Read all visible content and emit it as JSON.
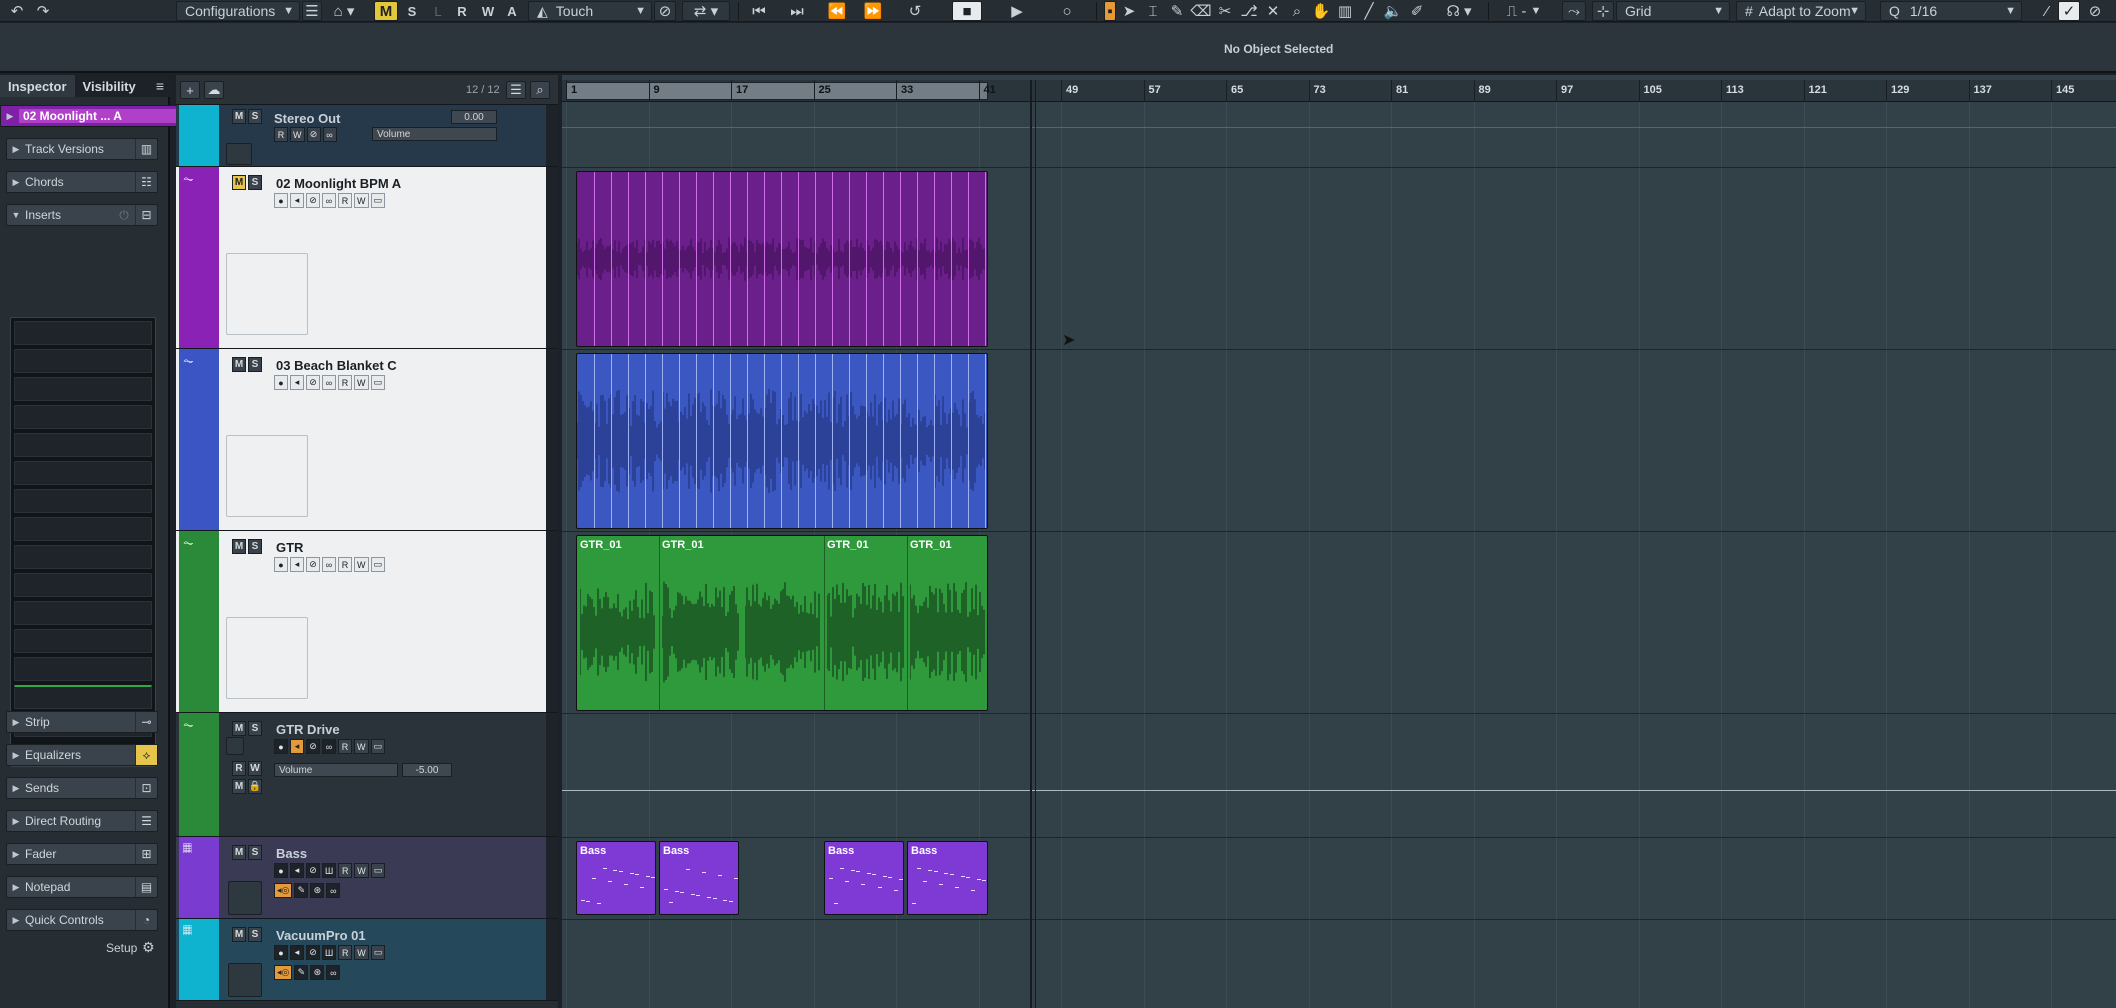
{
  "toolbar": {
    "configurations_label": "Configurations",
    "automation_mode": "Touch",
    "grid_type": "Grid",
    "zoom_mode": "Adapt to Zoom",
    "quantize_value": "1/16",
    "mute_indicator": "M",
    "solo_indicator": "S",
    "listen_indicator": "L",
    "read_indicator": "R",
    "write_indicator": "W",
    "auto_indicator": "A",
    "nudge_value": "-"
  },
  "info_line": {
    "status": "No Object Selected"
  },
  "inspector": {
    "tabs": [
      "Inspector",
      "Visibility"
    ],
    "track_name": "02 Moonlight ... A",
    "sections_top": [
      "Track Versions",
      "Chords",
      "Inserts"
    ],
    "sections_bottom": [
      "Strip",
      "Equalizers",
      "Sends",
      "Direct Routing",
      "Fader",
      "Notepad",
      "Quick Controls"
    ],
    "setup_label": "Setup"
  },
  "tracklist": {
    "track_count": "12 / 12",
    "tracks": [
      {
        "name": "Stereo Out",
        "color": "#0fb3d0",
        "volume_label": "Volume",
        "volume_value": "0.00"
      },
      {
        "name": "02 Moonlight BPM A",
        "color": "#8a22b5"
      },
      {
        "name": "03 Beach Blanket C",
        "color": "#3b55c4"
      },
      {
        "name": "GTR",
        "color": "#2a8a3a"
      },
      {
        "name": "GTR Drive",
        "color": "#2a8a3a",
        "volume_label": "Volume",
        "volume_value": "-5.00"
      },
      {
        "name": "Bass",
        "color": "#7a3bd0"
      },
      {
        "name": "VacuumPro 01",
        "color": "#0fb3d0"
      }
    ]
  },
  "ruler": {
    "bars": [
      "1",
      "9",
      "17",
      "25",
      "33",
      "41",
      "49",
      "57",
      "65",
      "73",
      "81",
      "89",
      "97",
      "105",
      "113",
      "121",
      "129",
      "137",
      "145"
    ]
  },
  "clips": {
    "gtr": [
      "GTR_01",
      "GTR_01",
      "GTR_01",
      "GTR_01"
    ],
    "bass": [
      "Bass",
      "Bass",
      "Bass",
      "Bass"
    ]
  },
  "colors": {
    "moonlight_clip": "#6a1f8a",
    "beach_clip": "#3a57c2",
    "gtr_clip": "#2f9a3c",
    "bass_clip": "#7f3ad6",
    "arrange_bg": "#324048"
  }
}
